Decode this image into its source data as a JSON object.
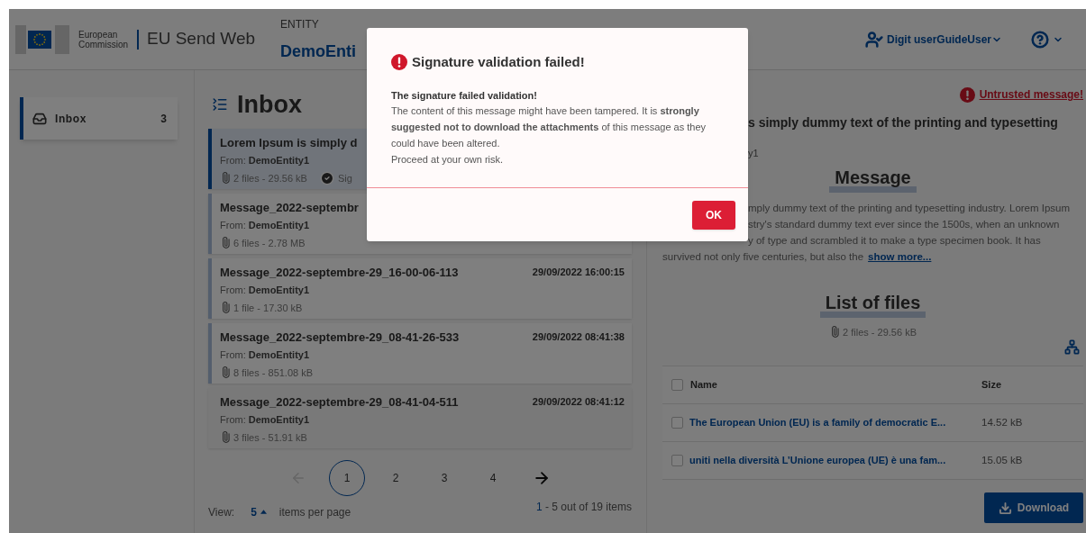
{
  "header": {
    "org": "European Commission",
    "app": "EU Send Web",
    "entity_label": "ENTITY",
    "entity": "DemoEnti",
    "user": "Digit userGuideUser"
  },
  "sidebar": {
    "items": [
      {
        "label": "Inbox",
        "count": "3",
        "selected": true
      }
    ]
  },
  "inbox": {
    "title": "Inbox",
    "messages": [
      {
        "title": "Lorem Ipsum is simply d",
        "from_label": "From:",
        "from": "DemoEntity1",
        "files": "2 files - 29.56 kB",
        "signature": "Sig",
        "selected": true,
        "unread": true
      },
      {
        "title": "Message_2022-septembr",
        "from_label": "From:",
        "from": "DemoEntity1",
        "files": "6 files - 2.78 MB",
        "selected": false,
        "unread": true
      },
      {
        "title": "Message_2022-septembre-29_16-00-06-113",
        "from_label": "From:",
        "from": "DemoEntity1",
        "files": "1 file - 17.30 kB",
        "date": "29/09/2022 16:00:15",
        "selected": false,
        "unread": true
      },
      {
        "title": "Message_2022-septembre-29_08-41-26-533",
        "from_label": "From:",
        "from": "DemoEntity1",
        "files": "8 files - 851.08 kB",
        "date": "29/09/2022 08:41:38",
        "selected": false,
        "unread": true
      },
      {
        "title": "Message_2022-septembre-29_08-41-04-511",
        "from_label": "From:",
        "from": "DemoEntity1",
        "files": "3 files - 51.91 kB",
        "date": "29/09/2022 08:41:12",
        "selected": false,
        "unread": false
      }
    ],
    "pagination": {
      "prev_disabled": true,
      "pages": [
        {
          "label": "1",
          "selected": true
        },
        {
          "label": "2",
          "selected": false
        },
        {
          "label": "3",
          "selected": false
        },
        {
          "label": "4",
          "selected": false
        }
      ]
    },
    "view_label": "View:",
    "per_page": "5",
    "per_page_label": "items per page",
    "range_start": "1",
    "range_rest": " - 5 out of 19 items"
  },
  "detail": {
    "warning": "Untrusted message!",
    "title": "s simply dummy text of the printing and typesetting",
    "from": "y1",
    "message_heading": "Message",
    "covered_lines": [
      "mply dummy text of the printing and typesetting industry. Lorem Ipsum",
      "stry's standard dummy text ever since the 1500s, when an unknown",
      "y of type and scrambled it to make a type specimen book. It has"
    ],
    "lines": [
      "survived not only five centuries, but also the"
    ],
    "show_more": "show more...",
    "files_heading": "List of files",
    "files_summary": "2 files - 29.56 kB",
    "table": {
      "columns": [
        "Name",
        "Size"
      ],
      "header_checked": false,
      "rows": [
        {
          "name": "The European Union (EU) is a family of democratic E...",
          "size": "14.52 kB",
          "checked": false
        },
        {
          "name": "uniti nella diversità L’Unione europea (UE) è una fam...",
          "size": "15.05 kB",
          "checked": false
        }
      ]
    },
    "download": "Download"
  },
  "dialog": {
    "title": "Signature validation failed!",
    "lead": "The signature failed validation!",
    "body": "The content of this message might have been tampered. It is **strongly suggested not to download the attachments** of this message as they could have been altered.",
    "note": "Proceed at your own risk.",
    "ok": "OK"
  }
}
